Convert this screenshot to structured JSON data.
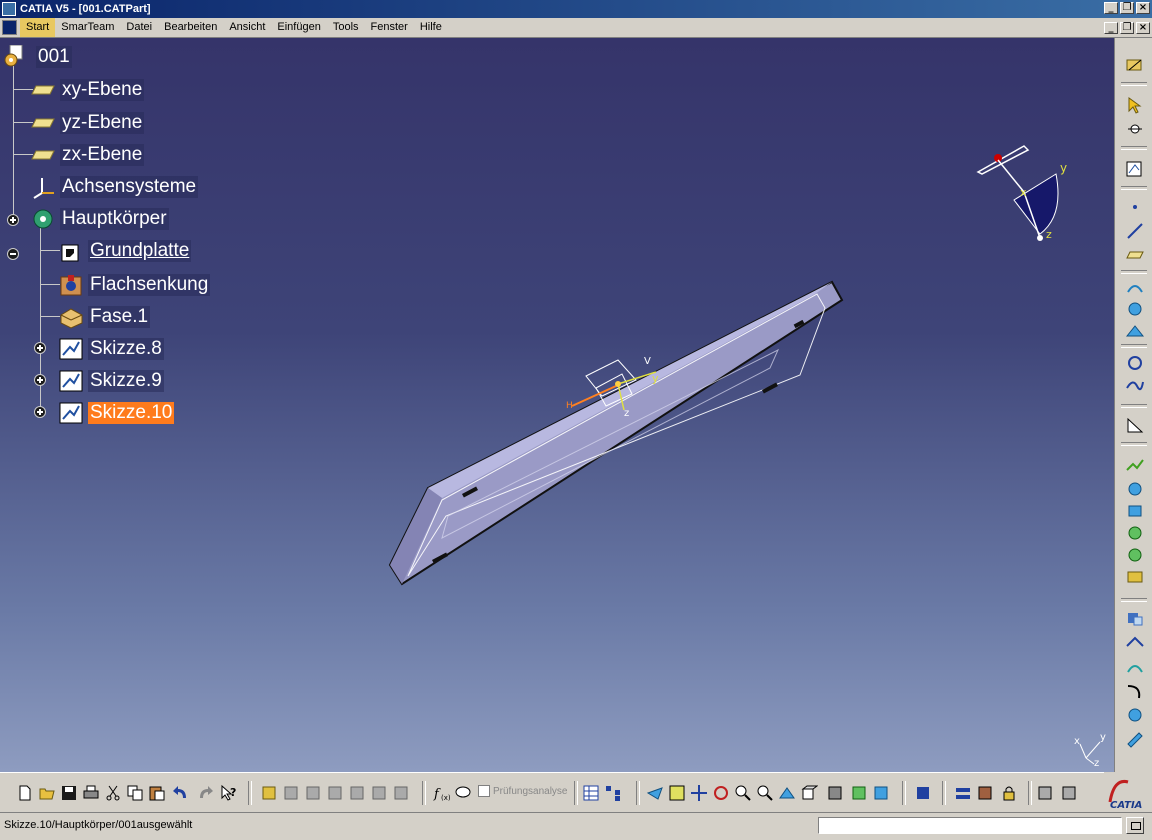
{
  "window": {
    "title": "CATIA V5 - [001.CATPart]",
    "minimize_glyph": "_",
    "restore_glyph": "❐",
    "close_glyph": "×"
  },
  "menu": {
    "items": [
      "Start",
      "SmarTeam",
      "Datei",
      "Bearbeiten",
      "Ansicht",
      "Einfügen",
      "Tools",
      "Fenster",
      "Hilfe"
    ]
  },
  "tree": {
    "root": "001",
    "nodes": [
      {
        "label": "xy-Ebene",
        "icon": "plane-icon"
      },
      {
        "label": "yz-Ebene",
        "icon": "plane-icon"
      },
      {
        "label": "zx-Ebene",
        "icon": "plane-icon"
      },
      {
        "label": "Achsensysteme",
        "icon": "axis-system-icon"
      },
      {
        "label": "Hauptkörper",
        "icon": "body-icon"
      },
      {
        "label": "Grundplatte",
        "icon": "pad-icon"
      },
      {
        "label": "Flachsenkung",
        "icon": "hole-icon"
      },
      {
        "label": "Fase.1",
        "icon": "chamfer-icon"
      },
      {
        "label": "Skizze.8",
        "icon": "sketch-icon"
      },
      {
        "label": "Skizze.9",
        "icon": "sketch-icon"
      },
      {
        "label": "Skizze.10",
        "icon": "sketch-icon",
        "selected": true
      }
    ]
  },
  "compass": {
    "x_label": "x",
    "y_label": "y",
    "z_label": "z"
  },
  "axis_triad": {
    "x_label": "x",
    "y_label": "y",
    "z_label": "z"
  },
  "sketch_axes": {
    "h_label": "H",
    "v_label": "V",
    "y_label": "y",
    "z_label": "z"
  },
  "toolbar": {
    "checkbox_label": "Prüfungsanalyse"
  },
  "brand": {
    "logo_text": "CATIA"
  },
  "status": {
    "text": "Skizze.10/Hauptkörper/001ausgewählt",
    "input_value": ""
  }
}
